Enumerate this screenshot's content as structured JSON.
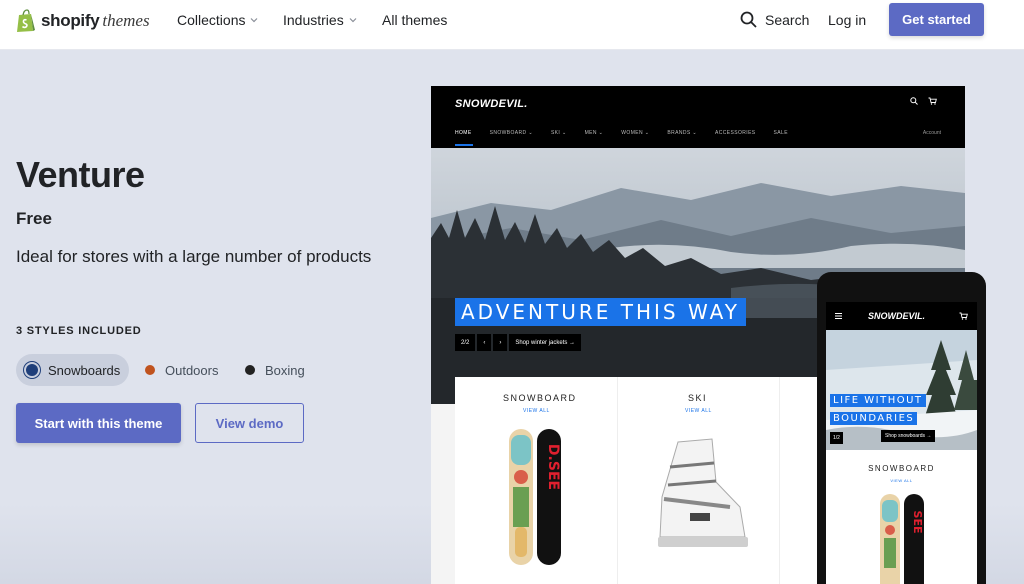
{
  "nav": {
    "logo_bold": "shopify",
    "logo_light": "themes",
    "links": [
      {
        "label": "Collections"
      },
      {
        "label": "Industries"
      },
      {
        "label": "All themes"
      }
    ],
    "search_label": "Search",
    "login_label": "Log in",
    "cta_label": "Get started"
  },
  "theme": {
    "name": "Venture",
    "price": "Free",
    "description": "Ideal for stores with a large number of products",
    "styles_label": "3 STYLES INCLUDED",
    "styles": [
      {
        "label": "Snowboards",
        "color": "#1f3f7a",
        "selected": true
      },
      {
        "label": "Outdoors",
        "color": "#c0531e",
        "selected": false
      },
      {
        "label": "Boxing",
        "color": "#222222",
        "selected": false
      }
    ],
    "primary_btn": "Start with this theme",
    "secondary_btn": "View demo"
  },
  "preview": {
    "brand": "SNOWDEVIL.",
    "menu": [
      "HOME",
      "SNOWBOARD ⌄",
      "SKI ⌄",
      "MEN ⌄",
      "WOMEN ⌄",
      "BRANDS ⌄",
      "ACCESSORIES",
      "SALE"
    ],
    "account": "Account",
    "banner": "ADVENTURE THIS WAY",
    "slide_count": "2/2",
    "prev": "‹",
    "next": "›",
    "shop_cta": "Shop winter jackets →",
    "card1_title": "SNOWBOARD",
    "card1_link": "VIEW ALL",
    "card2_title": "SKI",
    "card2_link": "VIEW ALL"
  },
  "mobile": {
    "brand": "SNOWDEVIL.",
    "banner_line1": "LIFE WITHOUT",
    "banner_line2": "BOUNDARIES",
    "cta": "Shop snowboards →",
    "slide_count": "1/2",
    "card_title": "SNOWBOARD",
    "card_link": "VIEW ALL"
  },
  "colors": {
    "accent": "#5c6ac4",
    "hero_bg": "#dfe3ed",
    "preview_blue": "#1a73e8"
  }
}
